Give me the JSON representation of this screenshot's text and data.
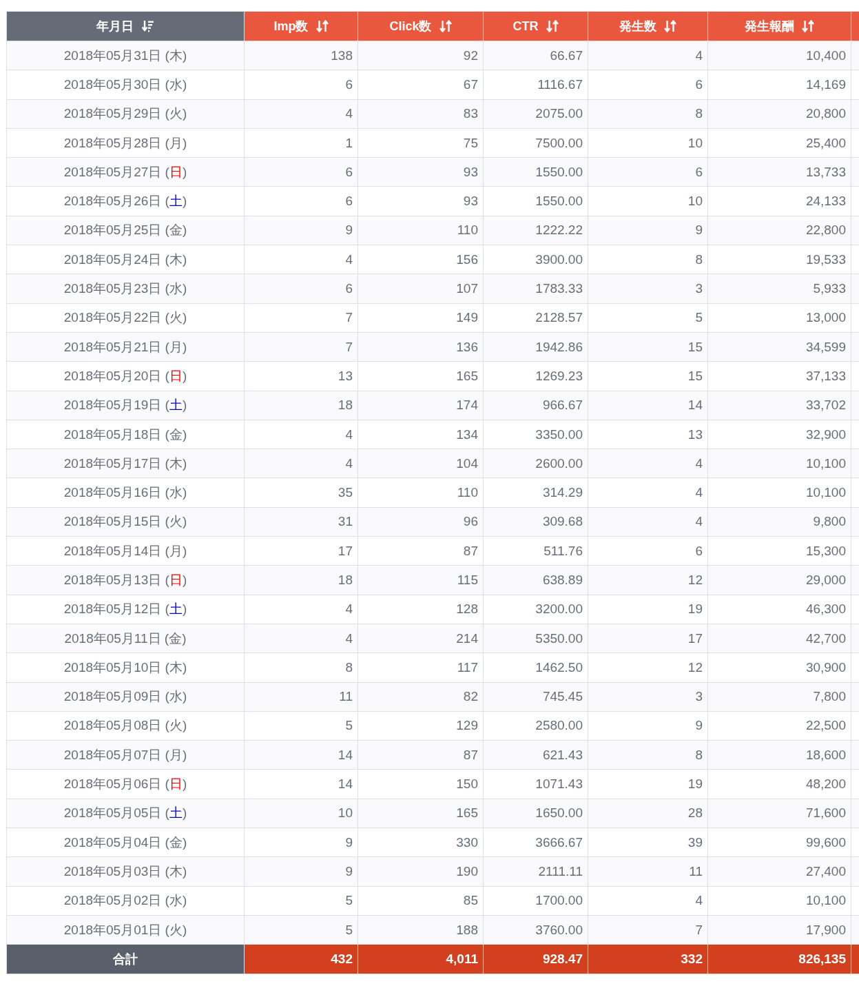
{
  "table": {
    "columns": [
      {
        "label": "年月日",
        "sorted": true
      },
      {
        "label": "Imp数",
        "sorted": false
      },
      {
        "label": "Click数",
        "sorted": false
      },
      {
        "label": "CTR",
        "sorted": false
      },
      {
        "label": "発生数",
        "sorted": false
      },
      {
        "label": "発生報酬",
        "sorted": false
      }
    ],
    "rows": [
      {
        "date": "2018年05月31日",
        "open": "(",
        "weekday": "木",
        "close": ")",
        "color": "#666e7a",
        "values": [
          "138",
          "92",
          "66.67",
          "4",
          "10,400"
        ]
      },
      {
        "date": "2018年05月30日",
        "open": "(",
        "weekday": "水",
        "close": ")",
        "color": "#666e7a",
        "values": [
          "6",
          "67",
          "1116.67",
          "6",
          "14,169"
        ]
      },
      {
        "date": "2018年05月29日",
        "open": "(",
        "weekday": "火",
        "close": ")",
        "color": "#666e7a",
        "values": [
          "4",
          "83",
          "2075.00",
          "8",
          "20,800"
        ]
      },
      {
        "date": "2018年05月28日",
        "open": "(",
        "weekday": "月",
        "close": ")",
        "color": "#666e7a",
        "values": [
          "1",
          "75",
          "7500.00",
          "10",
          "25,400"
        ]
      },
      {
        "date": "2018年05月27日",
        "open": "(",
        "weekday": "日",
        "close": ")",
        "color": "#ee0000",
        "values": [
          "6",
          "93",
          "1550.00",
          "6",
          "13,733"
        ]
      },
      {
        "date": "2018年05月26日",
        "open": "(",
        "weekday": "土",
        "close": ")",
        "color": "#0000cc",
        "values": [
          "6",
          "93",
          "1550.00",
          "10",
          "24,133"
        ]
      },
      {
        "date": "2018年05月25日",
        "open": "(",
        "weekday": "金",
        "close": ")",
        "color": "#666e7a",
        "values": [
          "9",
          "110",
          "1222.22",
          "9",
          "22,800"
        ]
      },
      {
        "date": "2018年05月24日",
        "open": "(",
        "weekday": "木",
        "close": ")",
        "color": "#666e7a",
        "values": [
          "4",
          "156",
          "3900.00",
          "8",
          "19,533"
        ]
      },
      {
        "date": "2018年05月23日",
        "open": "(",
        "weekday": "水",
        "close": ")",
        "color": "#666e7a",
        "values": [
          "6",
          "107",
          "1783.33",
          "3",
          "5,933"
        ]
      },
      {
        "date": "2018年05月22日",
        "open": "(",
        "weekday": "火",
        "close": ")",
        "color": "#666e7a",
        "values": [
          "7",
          "149",
          "2128.57",
          "5",
          "13,000"
        ]
      },
      {
        "date": "2018年05月21日",
        "open": "(",
        "weekday": "月",
        "close": ")",
        "color": "#666e7a",
        "values": [
          "7",
          "136",
          "1942.86",
          "15",
          "34,599"
        ]
      },
      {
        "date": "2018年05月20日",
        "open": "(",
        "weekday": "日",
        "close": ")",
        "color": "#ee0000",
        "values": [
          "13",
          "165",
          "1269.23",
          "15",
          "37,133"
        ]
      },
      {
        "date": "2018年05月19日",
        "open": "(",
        "weekday": "土",
        "close": ")",
        "color": "#0000cc",
        "values": [
          "18",
          "174",
          "966.67",
          "14",
          "33,702"
        ]
      },
      {
        "date": "2018年05月18日",
        "open": "(",
        "weekday": "金",
        "close": ")",
        "color": "#666e7a",
        "values": [
          "4",
          "134",
          "3350.00",
          "13",
          "32,900"
        ]
      },
      {
        "date": "2018年05月17日",
        "open": "(",
        "weekday": "木",
        "close": ")",
        "color": "#666e7a",
        "values": [
          "4",
          "104",
          "2600.00",
          "4",
          "10,100"
        ]
      },
      {
        "date": "2018年05月16日",
        "open": "(",
        "weekday": "水",
        "close": ")",
        "color": "#666e7a",
        "values": [
          "35",
          "110",
          "314.29",
          "4",
          "10,100"
        ]
      },
      {
        "date": "2018年05月15日",
        "open": "(",
        "weekday": "火",
        "close": ")",
        "color": "#666e7a",
        "values": [
          "31",
          "96",
          "309.68",
          "4",
          "9,800"
        ]
      },
      {
        "date": "2018年05月14日",
        "open": "(",
        "weekday": "月",
        "close": ")",
        "color": "#666e7a",
        "values": [
          "17",
          "87",
          "511.76",
          "6",
          "15,300"
        ]
      },
      {
        "date": "2018年05月13日",
        "open": "(",
        "weekday": "日",
        "close": ")",
        "color": "#ee0000",
        "values": [
          "18",
          "115",
          "638.89",
          "12",
          "29,000"
        ]
      },
      {
        "date": "2018年05月12日",
        "open": "(",
        "weekday": "土",
        "close": ")",
        "color": "#0000cc",
        "values": [
          "4",
          "128",
          "3200.00",
          "19",
          "46,300"
        ]
      },
      {
        "date": "2018年05月11日",
        "open": "(",
        "weekday": "金",
        "close": ")",
        "color": "#666e7a",
        "values": [
          "4",
          "214",
          "5350.00",
          "17",
          "42,700"
        ]
      },
      {
        "date": "2018年05月10日",
        "open": "(",
        "weekday": "木",
        "close": ")",
        "color": "#666e7a",
        "values": [
          "8",
          "117",
          "1462.50",
          "12",
          "30,900"
        ]
      },
      {
        "date": "2018年05月09日",
        "open": "(",
        "weekday": "水",
        "close": ")",
        "color": "#666e7a",
        "values": [
          "11",
          "82",
          "745.45",
          "3",
          "7,800"
        ]
      },
      {
        "date": "2018年05月08日",
        "open": "(",
        "weekday": "火",
        "close": ")",
        "color": "#666e7a",
        "values": [
          "5",
          "129",
          "2580.00",
          "9",
          "22,500"
        ]
      },
      {
        "date": "2018年05月07日",
        "open": "(",
        "weekday": "月",
        "close": ")",
        "color": "#666e7a",
        "values": [
          "14",
          "87",
          "621.43",
          "8",
          "18,600"
        ]
      },
      {
        "date": "2018年05月06日",
        "open": "(",
        "weekday": "日",
        "close": ")",
        "color": "#ee0000",
        "values": [
          "14",
          "150",
          "1071.43",
          "19",
          "48,200"
        ]
      },
      {
        "date": "2018年05月05日",
        "open": "(",
        "weekday": "土",
        "close": ")",
        "color": "#0000cc",
        "values": [
          "10",
          "165",
          "1650.00",
          "28",
          "71,600"
        ]
      },
      {
        "date": "2018年05月04日",
        "open": "(",
        "weekday": "金",
        "close": ")",
        "color": "#666e7a",
        "values": [
          "9",
          "330",
          "3666.67",
          "39",
          "99,600"
        ]
      },
      {
        "date": "2018年05月03日",
        "open": "(",
        "weekday": "木",
        "close": ")",
        "color": "#666e7a",
        "values": [
          "9",
          "190",
          "2111.11",
          "11",
          "27,400"
        ]
      },
      {
        "date": "2018年05月02日",
        "open": "(",
        "weekday": "水",
        "close": ")",
        "color": "#666e7a",
        "values": [
          "5",
          "85",
          "1700.00",
          "4",
          "10,100"
        ]
      },
      {
        "date": "2018年05月01日",
        "open": "(",
        "weekday": "火",
        "close": ")",
        "color": "#666e7a",
        "values": [
          "5",
          "188",
          "3760.00",
          "7",
          "17,900"
        ]
      }
    ],
    "total": {
      "label": "合計",
      "values": [
        "432",
        "4,011",
        "928.47",
        "332",
        "826,135"
      ]
    }
  }
}
